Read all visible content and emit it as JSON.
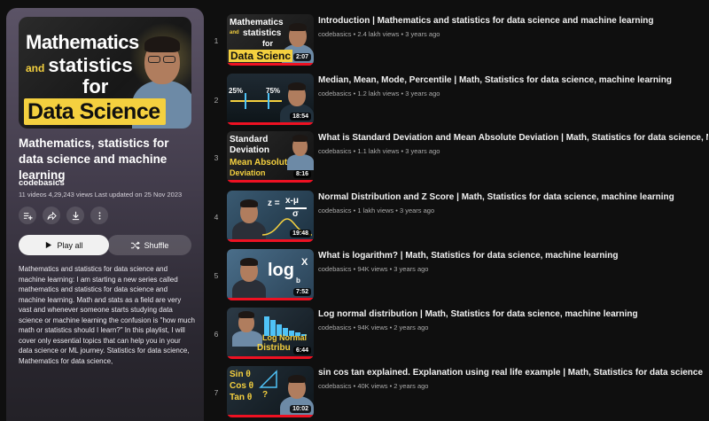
{
  "playlist": {
    "hero": {
      "line1": "Mathematics",
      "line2_small": "and",
      "line2": "statistics",
      "line3": "for",
      "line4": "Data Science"
    },
    "title": "Mathematics, statistics for data science and machine learning",
    "owner": "codebasics",
    "stats": "11 videos  4,29,243 views  Last updated on 25 Nov 2023",
    "play_label": "Play all",
    "shuffle_label": "Shuffle",
    "description": "Mathematics and statistics for data science and machine learning: I am starting a new series called mathematics and statistics for data science and machine learning. Math and stats as a field are very vast and whenever someone starts studying data science or machine learning the confusion is \"how much math or statistics should I learn?\" In this playlist, I will cover only essential topics that can help you in your data science or ML journey. Statistics for data science, Mathematics for data science,"
  },
  "videos": [
    {
      "index": "1",
      "title": "Introduction | Mathematics and statistics for data science and machine learning",
      "meta": "codebasics • 2.4 lakh views • 3 years ago",
      "duration": "2:07",
      "thumb_text": [
        "Mathematics",
        "and",
        "statistics",
        "for",
        "Data Scienc"
      ]
    },
    {
      "index": "2",
      "title": "Median, Mean, Mode, Percentile | Math, Statistics for data science, machine learning",
      "meta": "codebasics • 1.2 lakh views • 3 years ago",
      "duration": "18:54",
      "thumb_text": [
        "25%",
        "75%"
      ]
    },
    {
      "index": "3",
      "title": "What is Standard Deviation and Mean Absolute Deviation | Math, Statistics for data science, ML",
      "meta": "codebasics • 1.1 lakh views • 3 years ago",
      "duration": "8:16",
      "thumb_text": [
        "Standard",
        "Deviation",
        "Mean Absolute",
        "Deviation"
      ]
    },
    {
      "index": "4",
      "title": "Normal Distribution and Z Score | Math, Statistics for data science, machine learning",
      "meta": "codebasics • 1 lakh views • 3 years ago",
      "duration": "19:48",
      "thumb_text": [
        "z = ",
        "x-μ",
        "σ"
      ]
    },
    {
      "index": "5",
      "title": "What is logarithm? | Math, Statistics for data science, machine learning",
      "meta": "codebasics • 94K views • 3 years ago",
      "duration": "7:52",
      "thumb_text": [
        "log",
        "b",
        "X"
      ]
    },
    {
      "index": "6",
      "title": "Log normal distribution | Math, Statistics for data science, machine learning",
      "meta": "codebasics • 94K views • 2 years ago",
      "duration": "6:44",
      "thumb_text": [
        "Log Normal",
        "Distribu"
      ]
    },
    {
      "index": "7",
      "title": "sin cos tan explained. Explanation using real life example | Math, Statistics for data science",
      "meta": "codebasics • 40K views • 2 years ago",
      "duration": "10:02",
      "thumb_text": [
        "Sin θ",
        "Cos θ",
        "Tan θ",
        "?"
      ]
    }
  ],
  "colors": {
    "accent_yellow": "#f4d03f",
    "progress_red": "#ee1122",
    "background": "#0f0f0f"
  },
  "icons": [
    "add-to-queue-icon",
    "share-icon",
    "download-icon",
    "more-vertical-icon",
    "play-icon",
    "shuffle-icon"
  ]
}
